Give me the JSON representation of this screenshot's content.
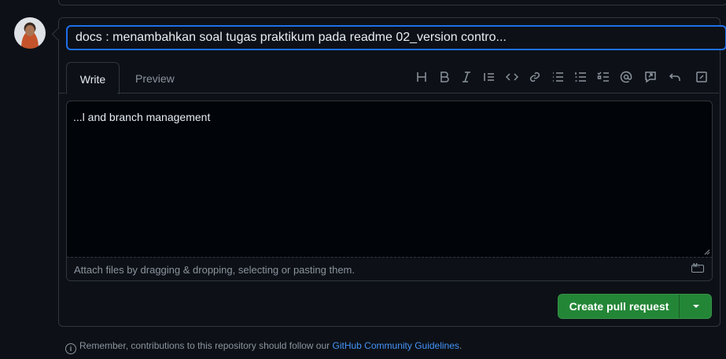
{
  "pr_form": {
    "title_value": "docs : menambahkan soal tugas praktikum pada readme 02_version contro...",
    "tabs": [
      {
        "label": "Write"
      },
      {
        "label": "Preview"
      }
    ],
    "toolbar_icons": [
      "heading-icon",
      "bold-icon",
      "italic-icon",
      "quote-icon",
      "code-icon",
      "link-icon",
      "unordered-list-icon",
      "ordered-list-icon",
      "task-list-icon",
      "mention-icon",
      "reference-icon",
      "undo-icon",
      "fullscreen-icon"
    ],
    "body_value": "...l and branch management",
    "attach_text": "Attach files by dragging & dropping, selecting or pasting them.",
    "submit_label": "Create pull request"
  },
  "footer": {
    "note_prefix": "Remember, contributions to this repository should follow our",
    "guidelines_link": "GitHub Community Guidelines",
    "note_suffix": "."
  },
  "colors": {
    "background": "#0d1117",
    "border": "#30363d",
    "focus": "#1f6feb",
    "primary_button": "#238636",
    "link": "#4493f8",
    "muted_text": "#8b949e"
  }
}
